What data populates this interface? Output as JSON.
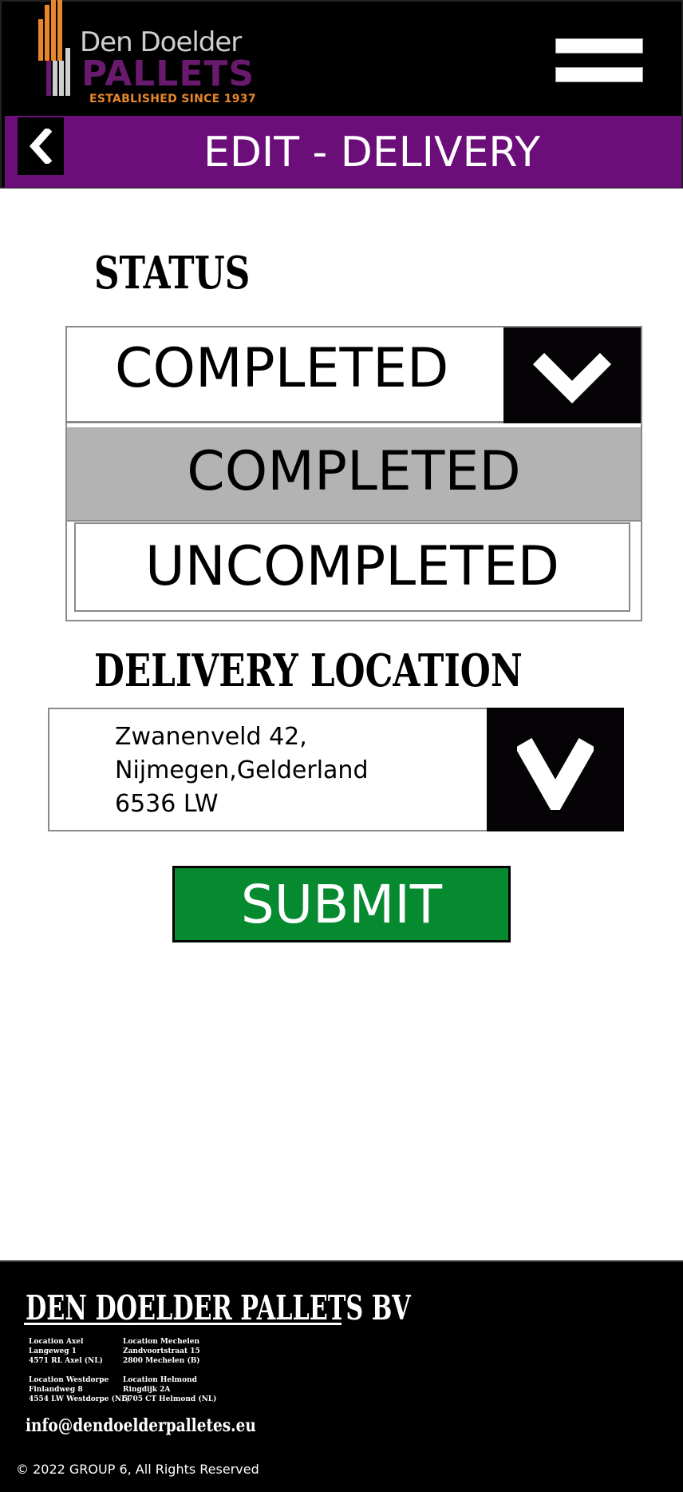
{
  "header": {
    "logo": {
      "name": "Den Doelder",
      "pallets": "PALLETS",
      "established": "ESTABLISHED SINCE 1937",
      "bar_colors": [
        "#e8862a",
        "#e8862a",
        "#e8862a",
        "#6a1a6e",
        "#6a1a6e",
        "#cfcfcf",
        "#cfcfcf"
      ]
    },
    "menu_icon": "hamburger-menu-icon",
    "back_icon": "chevron-left-icon",
    "page_title": "EDIT - DELIVERY"
  },
  "status": {
    "heading": "STATUS",
    "selected": "COMPLETED",
    "arrow_icon": "chevron-down-icon",
    "options": [
      "COMPLETED",
      "UNCOMPLETED"
    ]
  },
  "delivery_location": {
    "heading": "DELIVERY LOCATION",
    "lines": [
      "Zwanenveld  42,",
      "Nijmegen,Gelderland",
      "6536 LW"
    ],
    "arrow_icon": "chevron-down-icon"
  },
  "submit": {
    "label": "SUBMIT"
  },
  "footer": {
    "company": "DEN DOELDER PALLETS BV",
    "locations": [
      {
        "title": "Location Axel",
        "line1": "Langeweg 1",
        "line2": "4571 RL Axel (NL)"
      },
      {
        "title": "Location Mechelen",
        "line1": "Zandvoortstraat 15",
        "line2": "2800 Mechelen (B)"
      },
      {
        "title": "Location Westdorpe",
        "line1": "Finlandweg 8",
        "line2": "4554 LW Westdorpe (NL)"
      },
      {
        "title": "Location Helmond",
        "line1": "Ringdijk 2A",
        "line2": "5705 CT Helmond (NL)"
      }
    ],
    "email": "info@dendoelderpalletes.eu",
    "copyright": "© 2022 GROUP 6, All Rights Reserved"
  },
  "colors": {
    "header_bg": "#000000",
    "title_bar": "#6b0e79",
    "submit_green": "#058a30",
    "selected_option": "#b3b3b3"
  }
}
